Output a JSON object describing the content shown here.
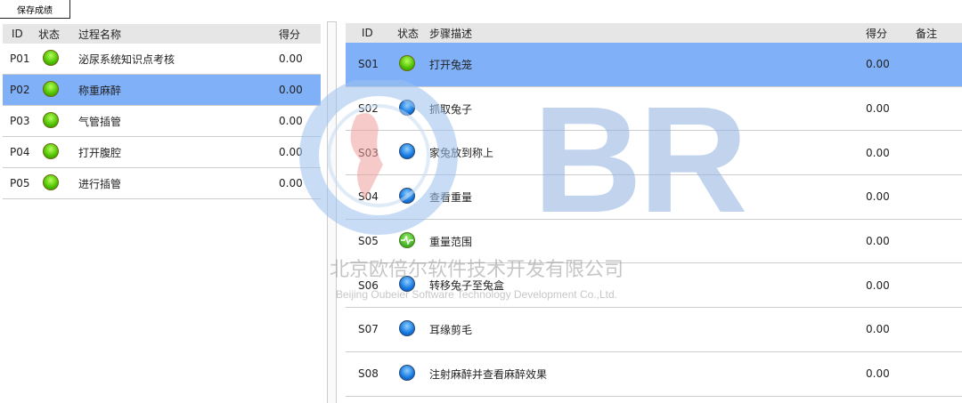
{
  "toolbar": {
    "save_label": "保存成绩"
  },
  "left": {
    "headers": {
      "id": "ID",
      "status": "状态",
      "name": "过程名称",
      "score": "得分"
    },
    "rows": [
      {
        "id": "P01",
        "status": "green",
        "name": "泌尿系统知识点考核",
        "score": "0.00"
      },
      {
        "id": "P02",
        "status": "green",
        "name": "称重麻醉",
        "score": "0.00",
        "selected": true
      },
      {
        "id": "P03",
        "status": "green",
        "name": "气管插管",
        "score": "0.00"
      },
      {
        "id": "P04",
        "status": "green",
        "name": "打开腹腔",
        "score": "0.00"
      },
      {
        "id": "P05",
        "status": "green",
        "name": "进行插管",
        "score": "0.00"
      }
    ]
  },
  "right": {
    "headers": {
      "id": "ID",
      "status": "状态",
      "desc": "步骤描述",
      "score": "得分",
      "note": "备注"
    },
    "rows": [
      {
        "id": "S01",
        "status": "green",
        "desc": "打开兔笼",
        "score": "0.00",
        "selected": true
      },
      {
        "id": "S02",
        "status": "blue",
        "desc": "抓取兔子",
        "score": "0.00"
      },
      {
        "id": "S03",
        "status": "blue",
        "desc": "家兔放到称上",
        "score": "0.00"
      },
      {
        "id": "S04",
        "status": "blue",
        "desc": "查看重量",
        "score": "0.00"
      },
      {
        "id": "S05",
        "status": "pulse",
        "desc": "重量范围",
        "score": "0.00"
      },
      {
        "id": "S06",
        "status": "blue",
        "desc": "转移兔子至兔盒",
        "score": "0.00"
      },
      {
        "id": "S07",
        "status": "blue",
        "desc": "耳缘剪毛",
        "score": "0.00"
      },
      {
        "id": "S08",
        "status": "blue",
        "desc": "注射麻醉并查看麻醉效果",
        "score": "0.00"
      }
    ]
  },
  "watermark": {
    "logo": "OBR",
    "cn": "北京欧倍尔软件技术开发有限公司",
    "en": "Beijing Oubeier Software Technology Development Co.,Ltd."
  }
}
